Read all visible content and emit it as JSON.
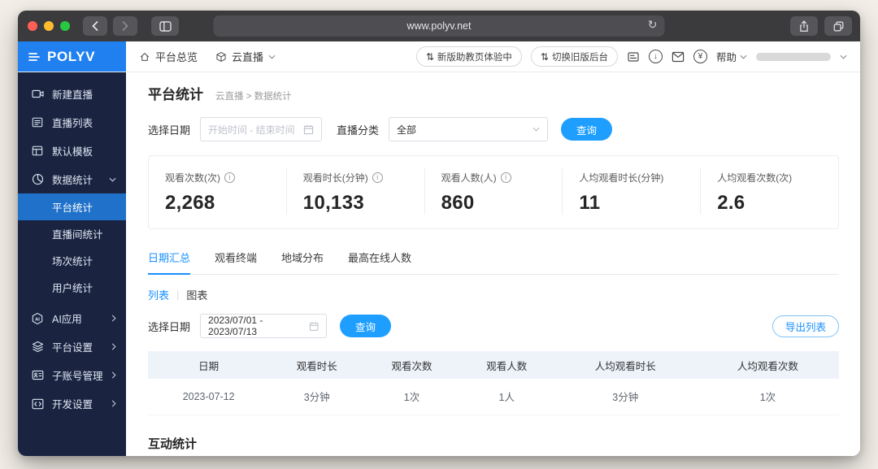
{
  "browser": {
    "url": "www.polyv.net"
  },
  "colors": {
    "brand_blue": "#2080f0",
    "sidebar_navy": "#1a2441",
    "active_item_blue": "#2071c9",
    "primary_button_blue": "#1e9fff",
    "link_blue": "#1890ff",
    "traffic_red": "#ff5f57",
    "traffic_yellow": "#febc2e",
    "traffic_green": "#28c840"
  },
  "icons": {
    "reload": "↻",
    "sort": "⇅",
    "download_arrow": "↓",
    "yen": "¥",
    "info": "i",
    "ai": "AI"
  },
  "logo": {
    "text": "POLYV"
  },
  "topnav": {
    "overview": "平台总览",
    "product": "云直播",
    "pill_new": "新版助教页体验中",
    "pill_old": "切换旧版后台",
    "help": "帮助"
  },
  "sidebar": {
    "items": [
      {
        "label": "新建直播"
      },
      {
        "label": "直播列表"
      },
      {
        "label": "默认模板"
      },
      {
        "label": "数据统计"
      }
    ],
    "subitems": [
      "平台统计",
      "直播间统计",
      "场次统计",
      "用户统计"
    ],
    "groups": [
      "AI应用",
      "平台设置",
      "子账号管理",
      "开发设置"
    ]
  },
  "page": {
    "title": "平台统计",
    "breadcrumb_parent": "云直播",
    "breadcrumb_sep": ">",
    "breadcrumb_current": "数据统计"
  },
  "filters": {
    "date_label": "选择日期",
    "date_placeholder": "开始时间 - 结束时间",
    "category_label": "直播分类",
    "category_value": "全部",
    "query_label": "查询"
  },
  "stats": [
    {
      "label": "观看次数(次)",
      "value": "2,268"
    },
    {
      "label": "观看时长(分钟)",
      "value": "10,133"
    },
    {
      "label": "观看人数(人)",
      "value": "860"
    },
    {
      "label": "人均观看时长(分钟)",
      "value": "11"
    },
    {
      "label": "人均观看次数(次)",
      "value": "2.6"
    }
  ],
  "tabs": [
    "日期汇总",
    "观看终端",
    "地域分布",
    "最高在线人数"
  ],
  "view_toggle": {
    "list": "列表",
    "chart": "图表"
  },
  "filters2": {
    "date_label": "选择日期",
    "date_value": "2023/07/01 - 2023/07/13",
    "query_label": "查询",
    "export_label": "导出列表"
  },
  "table": {
    "headers": [
      "日期",
      "观看时长",
      "观看次数",
      "观看人数",
      "人均观看时长",
      "人均观看次数"
    ],
    "rows": [
      [
        "2023-07-12",
        "3分钟",
        "1次",
        "1人",
        "3分钟",
        "1次"
      ]
    ]
  },
  "section2": {
    "title": "互动统计"
  }
}
